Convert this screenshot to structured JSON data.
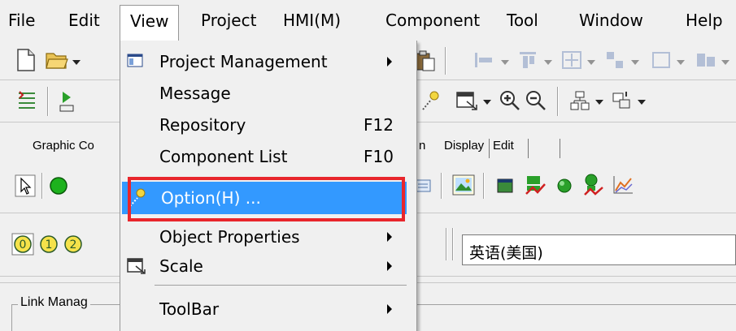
{
  "menubar": {
    "items": [
      "File",
      "Edit",
      "View",
      "Project",
      "HMI(M)",
      "Component",
      "Tool",
      "Window",
      "Help"
    ]
  },
  "tabs": {
    "graphic": "Graphic Co",
    "partial": "n",
    "display": "Display",
    "edit": "Edit"
  },
  "language_combo": {
    "value": "英语(美国)"
  },
  "link_panel": {
    "label": "Link Manag"
  },
  "view_menu": {
    "items": [
      {
        "label": "Project Management",
        "shortcut": "",
        "submenu": true
      },
      {
        "label": "Message",
        "shortcut": "",
        "submenu": false
      },
      {
        "label": "Repository",
        "shortcut": "F12",
        "submenu": false
      },
      {
        "label": "Component List",
        "shortcut": "F10",
        "submenu": false
      },
      {
        "label": "Option(H) ...",
        "shortcut": "",
        "submenu": false
      },
      {
        "label": "Object Properties",
        "shortcut": "",
        "submenu": true
      },
      {
        "label": "Scale",
        "shortcut": "",
        "submenu": true
      },
      {
        "label": "ToolBar",
        "shortcut": "",
        "submenu": true
      }
    ],
    "highlighted_index": 4
  },
  "colors": {
    "highlight": "#3399ff",
    "annotation": "#e8262c"
  }
}
